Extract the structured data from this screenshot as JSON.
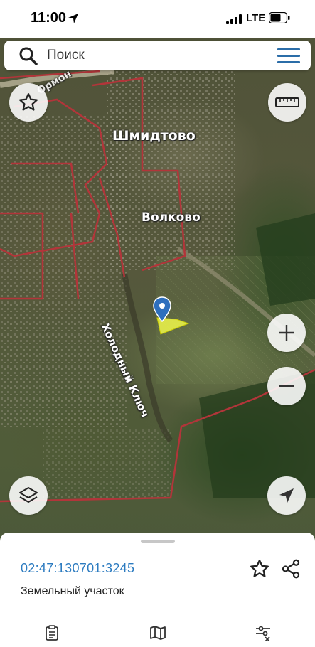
{
  "status_bar": {
    "time": "11:00",
    "network": "LTE"
  },
  "search": {
    "placeholder": "Поиск"
  },
  "map": {
    "labels": {
      "shmidtovo": "Шмидтово",
      "volkovo": "Волково",
      "river": "Холодный Ключ",
      "road": "Ормон"
    },
    "parcel_color": "#e8f04a",
    "boundary_color": "#b2353a",
    "pin_color": "#2e6fbd"
  },
  "parcel": {
    "cadastral_number": "02:47:130701:3245",
    "type": "Земельный участок"
  },
  "tabs": [
    {
      "icon": "clipboard-icon"
    },
    {
      "icon": "map-icon"
    },
    {
      "icon": "filter-icon"
    }
  ],
  "colors": {
    "accent": "#2c7bc0"
  }
}
